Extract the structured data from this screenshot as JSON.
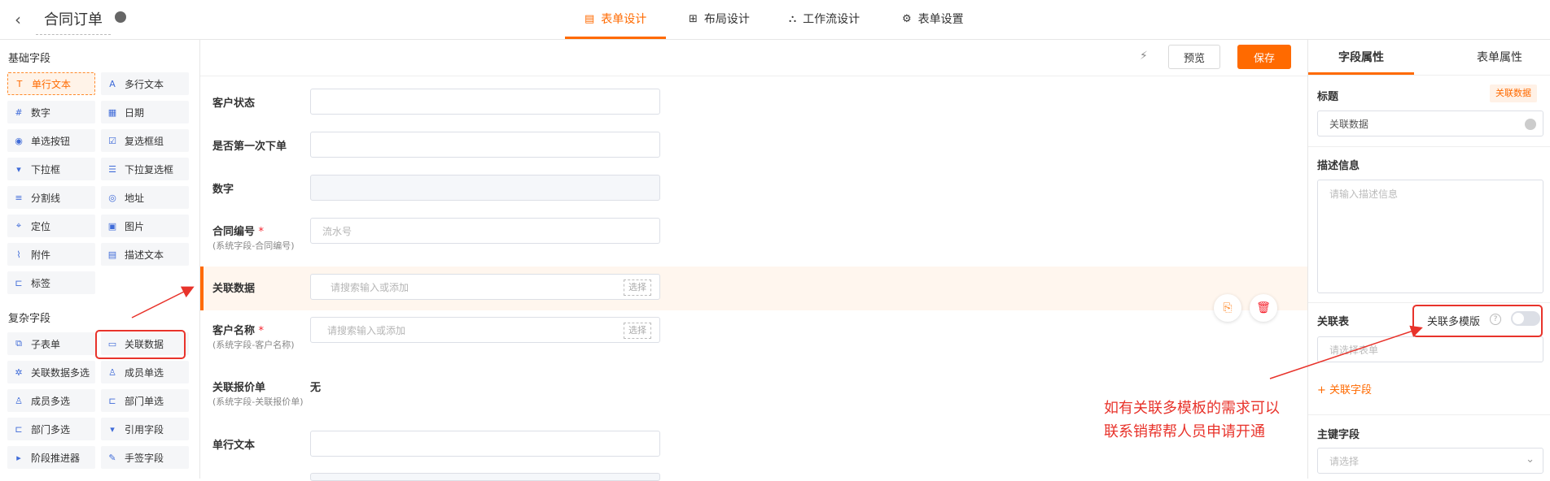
{
  "header": {
    "back_icon": "chevron-left-icon",
    "title": "合同订单",
    "tabs": [
      {
        "label": "表单设计",
        "icon": "form-icon",
        "active": true
      },
      {
        "label": "布局设计",
        "icon": "layout-icon"
      },
      {
        "label": "工作流设计",
        "icon": "workflow-icon"
      },
      {
        "label": "表单设置",
        "icon": "gear-icon"
      }
    ]
  },
  "left": {
    "basic_title": "基础字段",
    "basic": [
      "单行文本",
      "多行文本",
      "数字",
      "日期",
      "单选按钮",
      "复选框组",
      "下拉框",
      "下拉复选框",
      "分割线",
      "地址",
      "定位",
      "图片",
      "附件",
      "描述文本",
      "标签"
    ],
    "complex_title": "复杂字段",
    "complex": [
      "子表单",
      "关联数据",
      "关联数据多选",
      "成员单选",
      "成员多选",
      "部门单选",
      "部门多选",
      "引用字段",
      "阶段推进器",
      "手签字段"
    ]
  },
  "toolbar": {
    "preview": "预览",
    "save": "保存"
  },
  "form": {
    "rows": [
      {
        "label": "客户状态"
      },
      {
        "label": "是否第一次下单"
      },
      {
        "label": "数字"
      },
      {
        "label": "合同编号",
        "required": "*",
        "sub": "(系统字段-合同编号)",
        "placeholder": "流水号"
      },
      {
        "label": "关联数据",
        "placeholder": "请搜索输入或添加",
        "choose": "选择"
      },
      {
        "label": "客户名称",
        "required": "*",
        "sub": "(系统字段-客户名称)",
        "placeholder": "请搜索输入或添加",
        "choose": "选择"
      },
      {
        "label": "关联报价单",
        "sub": "(系统字段-关联报价单)",
        "value": "无"
      },
      {
        "label": "单行文本"
      }
    ]
  },
  "right": {
    "tabs": [
      "字段属性",
      "表单属性"
    ],
    "title_label": "标题",
    "title_tag": "关联数据",
    "title_value": "关联数据",
    "desc_label": "描述信息",
    "desc_placeholder": "请输入描述信息",
    "related_label": "关联表",
    "multi_template": "关联多模版",
    "related_placeholder": "请选择表单",
    "related_field": "+ 关联字段",
    "primary_label": "主键字段",
    "primary_placeholder": "请选择"
  },
  "annotation": {
    "line1": "如有关联多模板的需求可以",
    "line2": "联系销帮帮人员申请开通",
    "color": "#e8332b"
  },
  "accent": "#ff6a00"
}
